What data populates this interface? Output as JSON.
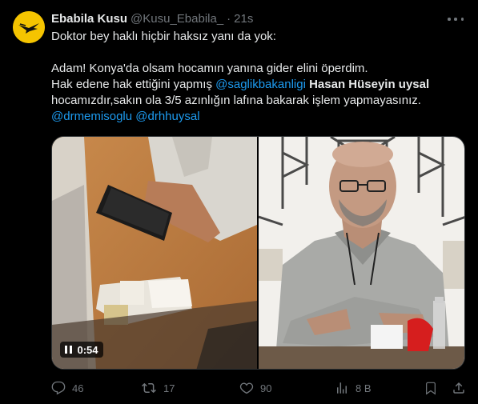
{
  "user": {
    "display_name": "Ebabila Kusu",
    "handle": "@Kusu_Ebabila_",
    "separator": "·",
    "time": "21s"
  },
  "tweet": {
    "line1": "Doktor bey haklı hiçbir haksız yanı da yok:",
    "line2": "Adam! Konya'da olsam hocamın yanına gider elini öperdim.",
    "line3_a": "Hak edene hak ettiğini yapmış ",
    "line3_mention": "@saglikbakanligi",
    "line3_space": " ",
    "line3_bold": "Hasan Hüseyin uysal",
    "line4": "hocamızdır,sakın ola 3/5 azınlığın lafına bakarak işlem yapmayasınız.",
    "mention1": "@drmemisoglu",
    "mention_space": " ",
    "mention2": "@drhhuysal"
  },
  "media": {
    "video_duration": "0:54"
  },
  "actions": {
    "replies": "46",
    "retweets": "17",
    "likes": "90",
    "views": "8 B"
  },
  "colors": {
    "background": "#000000",
    "text": "#e7e9ea",
    "muted": "#71767b",
    "link": "#1d9bf0",
    "avatar_bg": "#f5c400"
  }
}
